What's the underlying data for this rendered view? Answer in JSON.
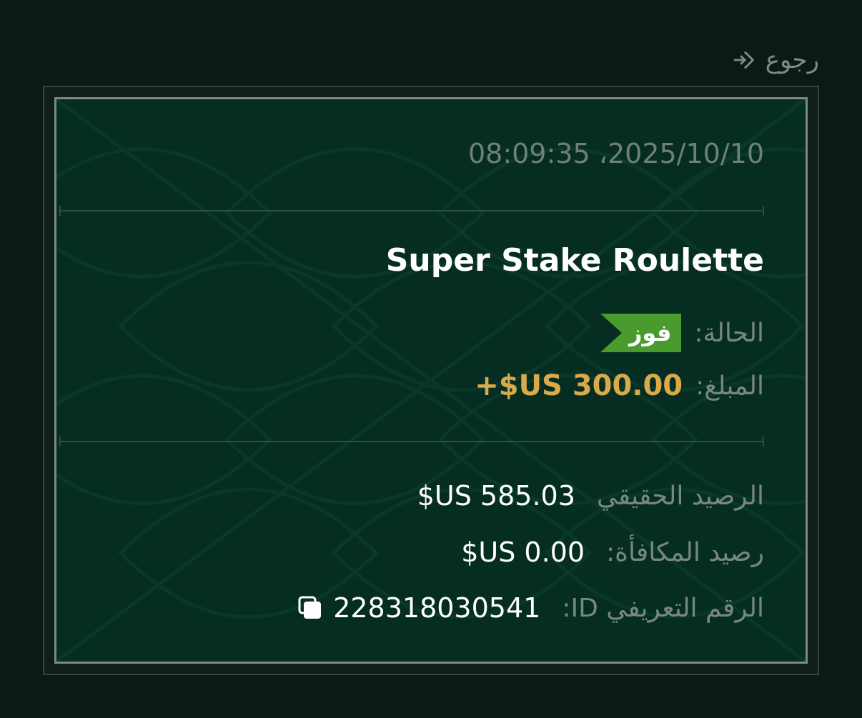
{
  "back": {
    "label": "رجوع",
    "icon": "back-arrow-icon"
  },
  "transaction": {
    "datetime": "08:09:35 ،2025/10/10",
    "game_title": "Super Stake Roulette",
    "status_label": "الحالة:",
    "status_value": "فوز",
    "amount_label": "المبلغ:",
    "amount_value": "+$US 300.00"
  },
  "balances": {
    "real_label": "الرصيد الحقيقي",
    "real_value": "$US 585.03",
    "bonus_label": "رصيد المكافأة:",
    "bonus_value": "$US 0.00",
    "id_label": "الرقم التعريفي ID:",
    "id_value": "228318030541",
    "copy_icon": "copy-icon"
  },
  "colors": {
    "background": "#0c1a17",
    "panel": "#062d22",
    "status_win": "#4a9b2d",
    "amount": "#d9a94a"
  }
}
